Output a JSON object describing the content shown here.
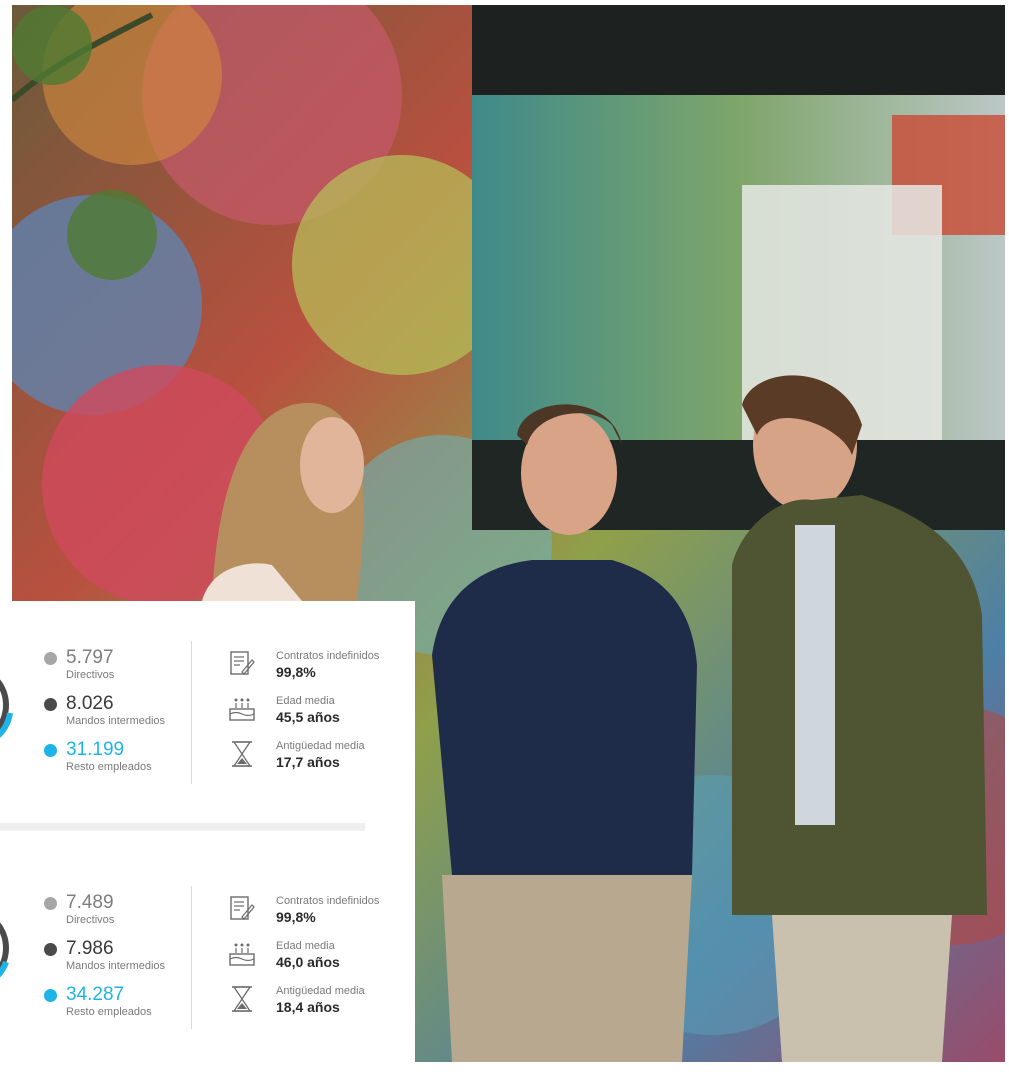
{
  "colors": {
    "directivos": "#a6a6a6",
    "mandos": "#4a4a4a",
    "resto": "#1fb4e8",
    "value_text": "#7d7d7d",
    "resto_text": "#1fb4e8"
  },
  "blocks": [
    {
      "stats": [
        {
          "value": "5.797",
          "label": "Directivos"
        },
        {
          "value": "8.026",
          "label": "Mandos intermedios"
        },
        {
          "value": "31.199",
          "label": "Resto empleados"
        }
      ],
      "facts": [
        {
          "icon": "contract-icon",
          "label": "Contratos indefinidos",
          "value": "99,8%"
        },
        {
          "icon": "birthday-cake-icon",
          "label": "Edad media",
          "value": "45,5 años"
        },
        {
          "icon": "hourglass-icon",
          "label": "Antigüedad media",
          "value": "17,7 años"
        }
      ]
    },
    {
      "stats": [
        {
          "value": "7.489",
          "label": "Directivos"
        },
        {
          "value": "7.986",
          "label": "Mandos intermedios"
        },
        {
          "value": "34.287",
          "label": "Resto empleados"
        }
      ],
      "facts": [
        {
          "icon": "contract-icon",
          "label": "Contratos indefinidos",
          "value": "99,8%"
        },
        {
          "icon": "birthday-cake-icon",
          "label": "Edad media",
          "value": "46,0 años"
        },
        {
          "icon": "hourglass-icon",
          "label": "Antigüedad media",
          "value": "18,4 años"
        }
      ]
    }
  ]
}
